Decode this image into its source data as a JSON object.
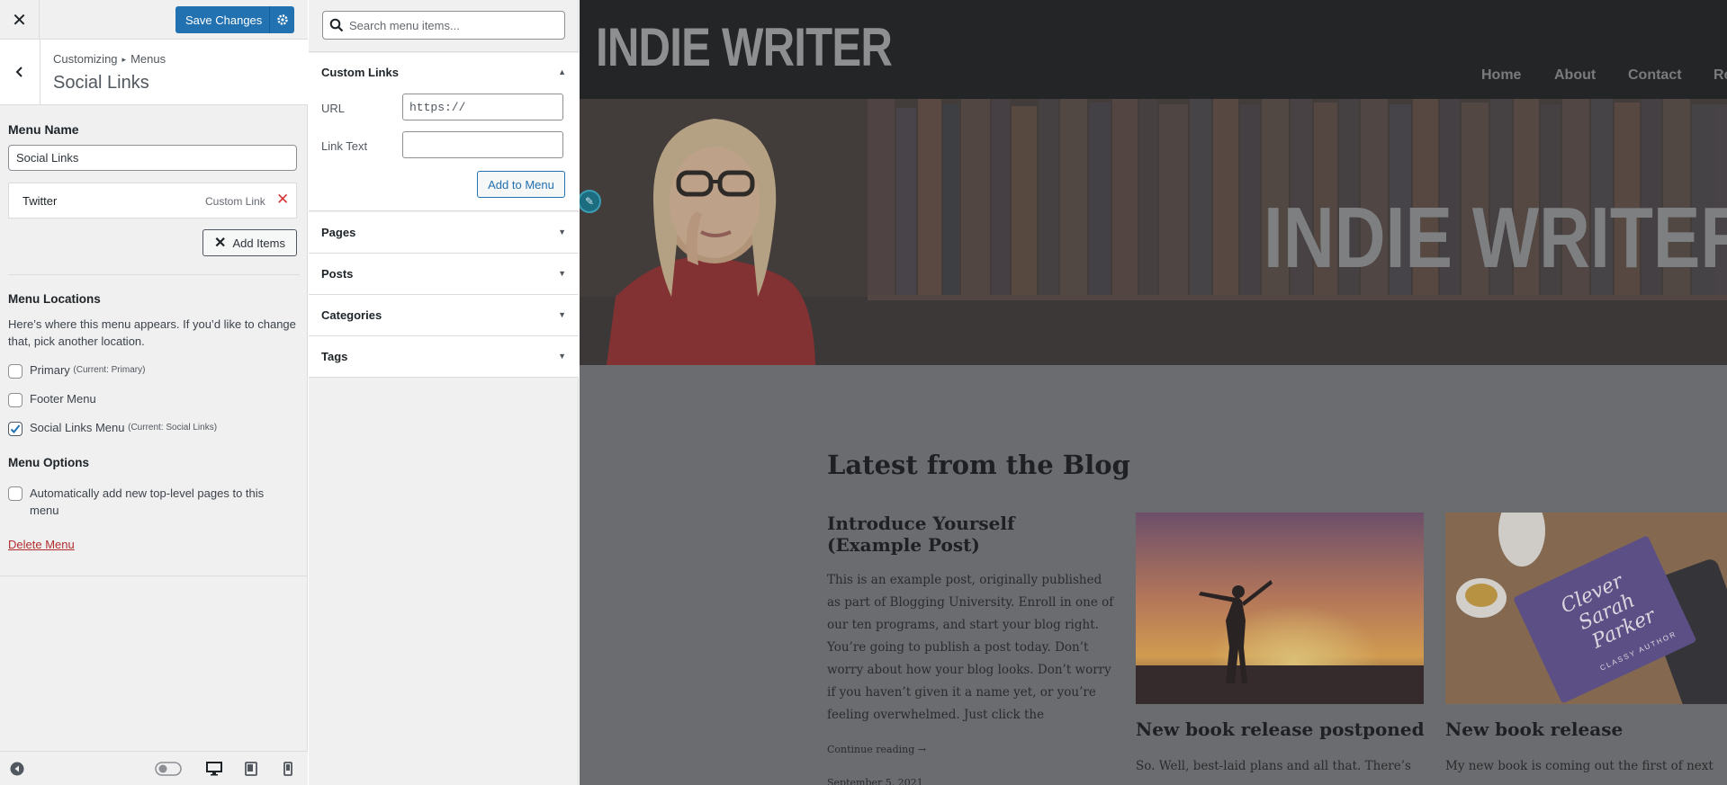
{
  "sidebar": {
    "close_label": "✕",
    "save_label": "Save Changes",
    "breadcrumb": {
      "root": "Customizing",
      "current": "Menus"
    },
    "panel_title": "Social Links",
    "menu_name": {
      "label": "Menu Name",
      "value": "Social Links"
    },
    "menu_items": [
      {
        "title": "Twitter",
        "type": "Custom Link"
      }
    ],
    "add_items_label": "Add Items",
    "locations": {
      "heading": "Menu Locations",
      "description": "Here’s where this menu appears. If you’d like to change that, pick another location.",
      "options": [
        {
          "label": "Primary",
          "note": "(Current: Primary)",
          "checked": false
        },
        {
          "label": "Footer Menu",
          "note": "",
          "checked": false
        },
        {
          "label": "Social Links Menu",
          "note": "(Current: Social Links)",
          "checked": true
        }
      ]
    },
    "options": {
      "heading": "Menu Options",
      "auto_add_label": "Automatically add new top-level pages to this menu",
      "auto_add_checked": false
    },
    "delete_label": "Delete Menu"
  },
  "items_panel": {
    "search_placeholder": "Search menu items...",
    "custom_links": {
      "title": "Custom Links",
      "url_label": "URL",
      "url_value": "https://",
      "link_text_label": "Link Text",
      "link_text_value": "",
      "add_button": "Add to Menu"
    },
    "sections": [
      "Pages",
      "Posts",
      "Categories",
      "Tags"
    ]
  },
  "preview": {
    "site_title": "INDIE WRITER",
    "nav": [
      "Home",
      "About",
      "Contact",
      "Re"
    ],
    "hero_title": "INDIE WRITER",
    "blog_heading": "Latest from the Blog",
    "posts": [
      {
        "title": "Introduce Yourself (Example Post)",
        "excerpt": "This is an example post, originally published as part of Blogging University. Enroll in one of our ten programs, and start your blog right. You’re going to publish a post today. Don’t worry about how your blog looks. Don’t worry if you haven’t given it a name yet, or you’re feeling overwhelmed. Just click the",
        "more": "Continue reading →",
        "date": "September 5, 2021"
      },
      {
        "title": "New book release postponed",
        "excerpt": "So. Well, best-laid plans and all that. There’s"
      },
      {
        "title": "New book release",
        "excerpt": "My new book is coming out the first of next"
      }
    ],
    "book_cover_text": [
      "Clever",
      "Sarah",
      "Parker",
      "CLASSY AUTHOR"
    ]
  },
  "colors": {
    "accent": "#2271b1",
    "danger": "#d63638",
    "overlay": "#6b6c6f"
  }
}
